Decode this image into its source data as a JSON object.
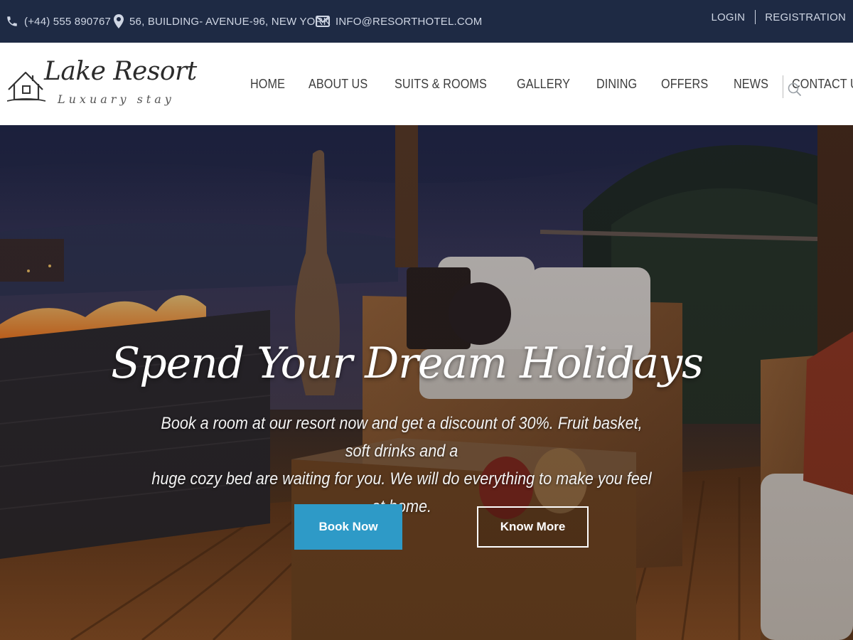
{
  "topbar": {
    "phone": "(+44) 555 890767",
    "address": "56, BUILDING- AVENUE-96, NEW YORK",
    "email": "INFO@RESORTHOTEL.COM",
    "login": "LOGIN",
    "registration": "REGISTRATION",
    "icons": [
      "phone-icon",
      "map-pin-icon",
      "mail-icon"
    ]
  },
  "logo": {
    "name": "Lake Resort",
    "tagline": "Luxuary stay",
    "icon": "house-icon"
  },
  "nav": {
    "items": [
      {
        "label": "HOME"
      },
      {
        "label": "ABOUT US"
      },
      {
        "label": "SUITS & ROOMS"
      },
      {
        "label": "GALLERY"
      },
      {
        "label": "DINING"
      },
      {
        "label": "OFFERS"
      },
      {
        "label": "NEWS"
      },
      {
        "label": "CONTACT US"
      }
    ],
    "search_icon": "search-icon"
  },
  "hero": {
    "title": "Spend Your Dream Holidays",
    "text_line1": "Book a room at our resort now and get a discount of 30%. Fruit basket, soft drinks and a",
    "text_line2": "huge cozy bed are waiting for you. We will do everything to make you feel at home.",
    "primary_button": "Book Now",
    "secondary_button": "Know More"
  },
  "colors": {
    "topbar_bg": "#1e2a44",
    "accent": "#2e9ac7",
    "nav_text": "#3c3c3c"
  }
}
